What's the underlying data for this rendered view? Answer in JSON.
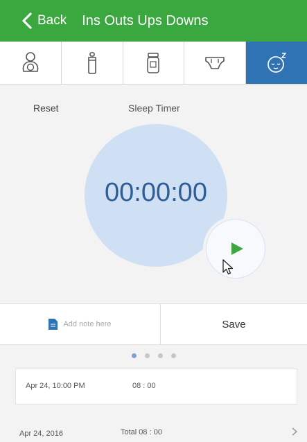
{
  "header": {
    "back_label": "Back",
    "title": "Ins Outs Ups Downs",
    "background": "#3aa83e"
  },
  "tabs": [
    {
      "icon": "baby-icon",
      "active": false
    },
    {
      "icon": "bottle-icon",
      "active": false
    },
    {
      "icon": "jar-icon",
      "active": false
    },
    {
      "icon": "diaper-icon",
      "active": false
    },
    {
      "icon": "sleeping-baby-icon",
      "active": true
    }
  ],
  "timer": {
    "reset_label": "Reset",
    "title": "Sleep Timer",
    "time": "00:00:00",
    "circle_color": "#cfdff4",
    "play_color": "#3aa83e"
  },
  "actions": {
    "note_placeholder": "Add note here",
    "save_label": "Save"
  },
  "pagination": {
    "total": 4,
    "active_index": 0
  },
  "entries": [
    {
      "date": "Apr 24, 10:00 PM",
      "duration": "08 : 00"
    }
  ],
  "summary": {
    "date": "Apr 24, 2016",
    "total": "Total 08 : 00"
  },
  "colors": {
    "accent_blue": "#2f73b5",
    "text_blue": "#2f5e95"
  }
}
